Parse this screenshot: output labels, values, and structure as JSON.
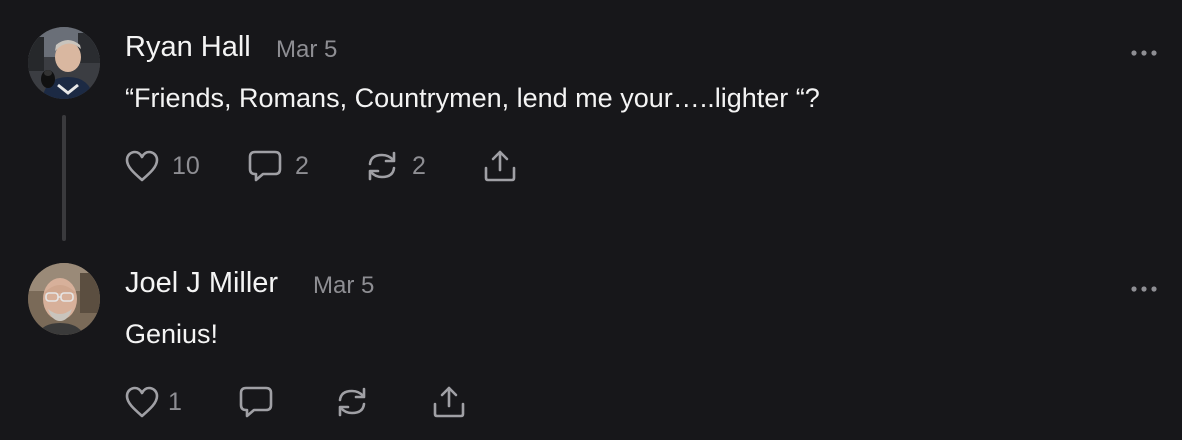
{
  "posts": [
    {
      "author": "Ryan Hall",
      "date": "Mar 5",
      "text": "“Friends, Romans, Countrymen, lend me your…..lighter “?",
      "likes": "10",
      "comments": "2",
      "restacks": "2"
    },
    {
      "author": "Joel J Miller",
      "date": "Mar 5",
      "text": "Genius!",
      "likes": "1",
      "comments": "",
      "restacks": ""
    }
  ],
  "colors": {
    "background": "#17171a",
    "text": "#f4f4f4",
    "muted": "#8e8e93",
    "icon": "#a0a0a5",
    "thread_line": "#3a3a3d"
  },
  "icons": {
    "like": "heart-icon",
    "comment": "speech-bubble-icon",
    "restack": "restack-arrows-icon",
    "share": "share-upload-icon",
    "more": "more-dots-icon"
  }
}
